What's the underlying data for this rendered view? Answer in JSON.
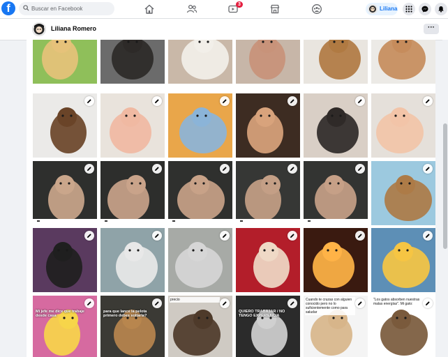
{
  "topbar": {
    "logo_letter": "f",
    "search_placeholder": "Buscar en Facebook",
    "notification_count": "3",
    "profile_name": "Liliana"
  },
  "profile": {
    "name": "Liliana Romero",
    "more_label": "···"
  },
  "photos": [
    {
      "name": "photo-golden-puppy",
      "bg": "#8fbf5a",
      "subject": "#e6c27a",
      "editable": false
    },
    {
      "name": "photo-pug-tongue",
      "bg": "#6b6b6b",
      "subject": "#2d2a28",
      "editable": false
    },
    {
      "name": "photo-fluffy-puppy",
      "bg": "#c9b8a8",
      "subject": "#f2efe9",
      "editable": false
    },
    {
      "name": "photo-teddy-pair",
      "bg": "#c7b6a8",
      "subject": "#c8937a",
      "editable": false
    },
    {
      "name": "photo-brown-fluffy-dog",
      "bg": "#e9e5df",
      "subject": "#b07a42",
      "editable": false
    },
    {
      "name": "photo-poodle-puppy",
      "bg": "#eceae6",
      "subject": "#c68c5c",
      "editable": false
    },
    {
      "name": "photo-teddy-dog",
      "bg": "#ebeae8",
      "subject": "#6a4428",
      "editable": true
    },
    {
      "name": "photo-baby-puppy",
      "bg": "#e9e3dc",
      "subject": "#f0b9a2",
      "editable": true
    },
    {
      "name": "photo-baby-dog-sunset",
      "bg": "#e9a64a",
      "subject": "#8bb4d8",
      "editable": true
    },
    {
      "name": "photo-baby-dog-couch",
      "bg": "#3d2c22",
      "subject": "#d8a37c",
      "editable": true
    },
    {
      "name": "photo-baby-kitten",
      "bg": "#d9cfc6",
      "subject": "#2f2a28",
      "editable": true
    },
    {
      "name": "photo-baby-puppy-2",
      "bg": "#e5e0da",
      "subject": "#f2c4a8",
      "editable": true
    },
    {
      "name": "photo-woman-mask-1",
      "bg": "#2e2f2d",
      "subject": "#caa68b",
      "editable": true,
      "strip": true
    },
    {
      "name": "photo-woman-mask-2",
      "bg": "#2d2e2c",
      "subject": "#c9a38a",
      "editable": true,
      "strip": true
    },
    {
      "name": "photo-woman-mask-3",
      "bg": "#2f302e",
      "subject": "#c8a288",
      "editable": true,
      "strip": true
    },
    {
      "name": "photo-woman-mask-4",
      "bg": "#363735",
      "subject": "#c49f86",
      "editable": true,
      "strip": true
    },
    {
      "name": "photo-woman-mask-5",
      "bg": "#333432",
      "subject": "#c6a087",
      "editable": true,
      "strip": true
    },
    {
      "name": "photo-faceshield-dog",
      "bg": "#9cc9df",
      "subject": "#ad7b47",
      "editable": true
    },
    {
      "name": "photo-masked-face",
      "bg": "#5a3a5f",
      "subject": "#1f1f1f",
      "editable": true
    },
    {
      "name": "photo-faceshield-man",
      "bg": "#8fa3a8",
      "subject": "#e8e8e8",
      "editable": true
    },
    {
      "name": "photo-faceshield-man-2",
      "bg": "#a7aaa6",
      "subject": "#d6d6d6",
      "editable": true
    },
    {
      "name": "photo-poodle-red",
      "bg": "#b31e2a",
      "subject": "#efd9c6",
      "editable": true
    },
    {
      "name": "photo-candles-wine",
      "bg": "#3a1a10",
      "subject": "#ffb347",
      "editable": true
    },
    {
      "name": "photo-beer-cartoon",
      "bg": "#5d8fb6",
      "subject": "#f6c543",
      "editable": true
    },
    {
      "name": "photo-simpsons-meme",
      "bg": "#d66aa0",
      "subject": "#f7d54a",
      "editable": true,
      "overlay": "Mi jefe me dice que trabaje desde casa"
    },
    {
      "name": "photo-ball-meme",
      "bg": "#3b3a35",
      "subject": "#b8864e",
      "editable": true,
      "overlay": "para que lance la pelota primero debes soltarla?"
    },
    {
      "name": "photo-dog-car",
      "bg": "#cfcac3",
      "subject": "#4e3a2a",
      "editable": true,
      "caption": "precio"
    },
    {
      "name": "photo-office-meme",
      "bg": "#2b2b2b",
      "subject": "#d0d0d0",
      "editable": true,
      "overlay": "QUIERO TRABAJAR / NO TENGO EXPERIENCIA"
    },
    {
      "name": "photo-cat-dog-meme",
      "bg": "#f4f4f4",
      "subject": "#d7b58a",
      "editable": true,
      "caption": "Cuando te cruzas con alguien conocido pero no lo suficientemente como para saludar"
    },
    {
      "name": "photo-cats-meme",
      "bg": "#ffffff",
      "subject": "#7a5a3c",
      "editable": true,
      "caption": "\"Los gatos absorben nuestras malas energías\". Mi gato:"
    }
  ],
  "colors": {
    "brand": "#1877f2",
    "badge": "#e41e3f",
    "page_bg": "#f0f2f5"
  }
}
